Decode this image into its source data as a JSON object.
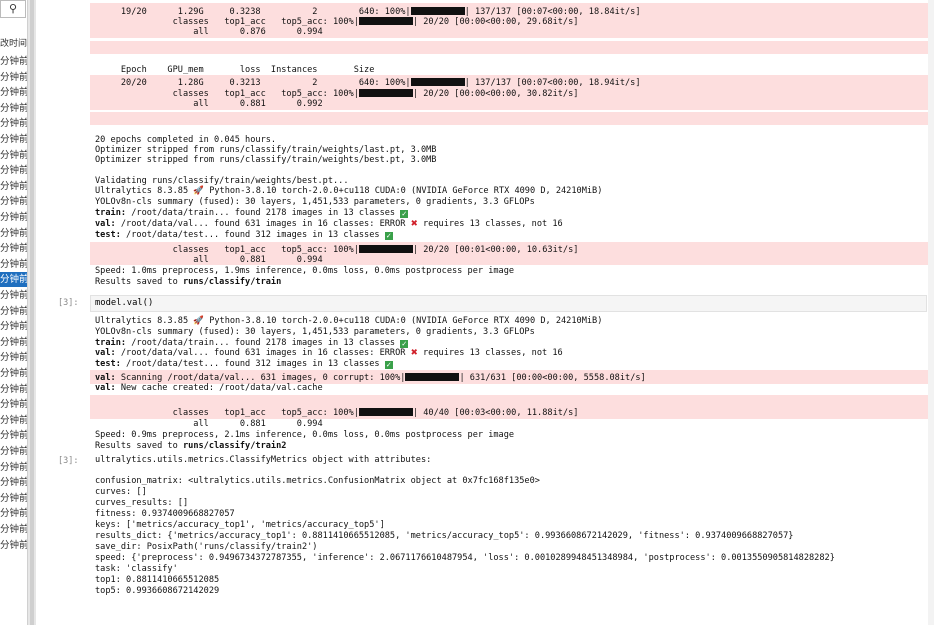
{
  "sidebar": {
    "search_icon": "search-icon",
    "column_header": "改时间",
    "items": [
      "分钟前",
      "分钟前",
      "分钟前",
      "分钟前",
      "分钟前",
      "分钟前",
      "分钟前",
      "分钟前",
      "分钟前",
      "分钟前",
      "分钟前",
      "分钟前",
      "分钟前",
      "分钟前",
      "分钟前",
      "分钟前",
      "分钟前",
      "分钟前",
      "分钟前",
      "分钟前",
      "分钟前",
      "分钟前",
      "分钟前",
      "分钟前",
      "分钟前",
      "分钟前",
      "分钟前",
      "分钟前",
      "分钟前",
      "分钟前",
      "分钟前",
      "分钟前"
    ],
    "selected_index": 14
  },
  "cells": {
    "cell3_prompt": "[3]:",
    "cell3_code": "model.val()",
    "out3_prompt": "[3]:"
  },
  "train": {
    "r1_epoch": "     19/20      1.29G     0.3238          2        640: 100%|",
    "r1_tail": "| 137/137 [00:07<00:00, 18.84it/s]",
    "r1_classes": "               classes   top1_acc   top5_acc: 100%|",
    "r1_classes_tail": "| 20/20 [00:00<00:00, 29.68it/s]",
    "r1_all": "                   all      0.876      0.994",
    "hdr": "     Epoch    GPU_mem       loss  Instances       Size",
    "r2_epoch": "     20/20      1.28G     0.3213          2        640: 100%|",
    "r2_tail": "| 137/137 [00:07<00:00, 18.94it/s]",
    "r2_classes": "               classes   top1_acc   top5_acc: 100%|",
    "r2_classes_tail": "| 20/20 [00:00<00:00, 30.82it/s]",
    "r2_all": "                   all      0.881      0.992",
    "done": "20 epochs completed in 0.045 hours.",
    "opt1": "Optimizer stripped from runs/classify/train/weights/last.pt, 3.0MB",
    "opt2": "Optimizer stripped from runs/classify/train/weights/best.pt, 3.0MB",
    "validating": "Validating runs/classify/train/weights/best.pt...",
    "ultra": "Ultralytics 8.3.85 ",
    "ultra_tail": " Python-3.8.10 torch-2.0.0+cu118 CUDA:0 (NVIDIA GeForce RTX 4090 D, 24210MiB)",
    "summary": "YOLOv8n-cls summary (fused): 30 layers, 1,451,533 parameters, 0 gradients, 3.3 GFLOPs",
    "train_lbl": "train:",
    "train_txt": " /root/data/train... found 2178 images in 13 classes ",
    "val_lbl": "val:",
    "val_txt": " /root/data/val... found 631 images in 16 classes: ERROR ",
    "val_err": " requires 13 classes, not 16",
    "test_lbl": "test:",
    "test_txt": " /root/data/test... found 312 images in 13 classes ",
    "v_classes": "               classes   top1_acc   top5_acc: 100%|",
    "v_classes_tail": "| 20/20 [00:01<00:00, 10.63it/s]",
    "v_all": "                   all      0.881      0.994",
    "speed": "Speed: 1.0ms preprocess, 1.9ms inference, 0.0ms loss, 0.0ms postprocess per image",
    "saved": "Results saved to ",
    "saved_path": "runs/classify/train"
  },
  "val": {
    "ultra": "Ultralytics 8.3.85 ",
    "ultra_tail": " Python-3.8.10 torch-2.0.0+cu118 CUDA:0 (NVIDIA GeForce RTX 4090 D, 24210MiB)",
    "summary": "YOLOv8n-cls summary (fused): 30 layers, 1,451,533 parameters, 0 gradients, 3.3 GFLOPs",
    "train_lbl": "train:",
    "train_txt": " /root/data/train... found 2178 images in 13 classes ",
    "val_lbl": "val:",
    "val_txt": " /root/data/val... found 631 images in 16 classes: ERROR ",
    "val_err": " requires 13 classes, not 16",
    "test_lbl": "test:",
    "test_txt": " /root/data/test... found 312 images in 13 classes ",
    "scan_lbl": "val:",
    "scan_txt": " Scanning /root/data/val... 631 images, 0 corrupt: 100%|",
    "scan_tail": "| 631/631 [00:00<00:00, 5558.08it/s]",
    "cache_lbl": "val:",
    "cache_txt": " New cache created: /root/data/val.cache",
    "classes": "               classes   top1_acc   top5_acc: 100%|",
    "classes_tail": "| 40/40 [00:03<00:00, 11.88it/s]",
    "all": "                   all      0.881      0.994",
    "speed": "Speed: 0.9ms preprocess, 2.1ms inference, 0.0ms loss, 0.0ms postprocess per image",
    "saved": "Results saved to ",
    "saved_path": "runs/classify/train2"
  },
  "metrics": {
    "l1": "ultralytics.utils.metrics.ClassifyMetrics object with attributes:",
    "l2": "confusion_matrix: <ultralytics.utils.metrics.ConfusionMatrix object at 0x7fc168f135e0>",
    "l3": "curves: []",
    "l4": "curves_results: []",
    "l5": "fitness: 0.9374009668827057",
    "l6": "keys: ['metrics/accuracy_top1', 'metrics/accuracy_top5']",
    "l7": "results_dict: {'metrics/accuracy_top1': 0.8811410665512085, 'metrics/accuracy_top5': 0.9936608672142029, 'fitness': 0.9374009668827057}",
    "l8": "save_dir: PosixPath('runs/classify/train2')",
    "l9": "speed: {'preprocess': 0.9496734372787355, 'inference': 2.0671176610487954, 'loss': 0.0010289948451348984, 'postprocess': 0.0013550905814828282}",
    "l10": "task: 'classify'",
    "l11": "top1: 0.8811410665512085",
    "l12": "top5: 0.9936608672142029"
  }
}
